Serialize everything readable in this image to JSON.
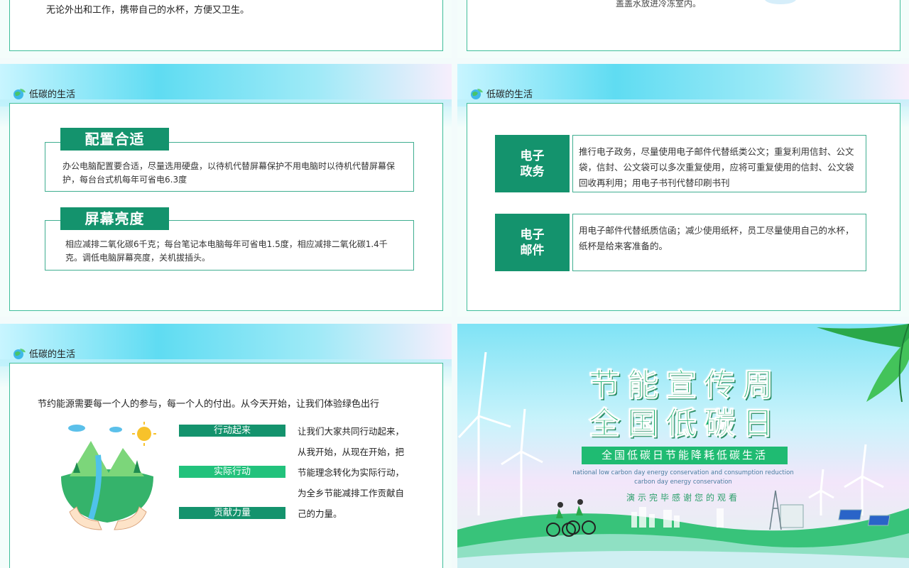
{
  "slide1": {
    "text": "无论外出和工作，携带自己的水杯，方便又卫生。"
  },
  "slide2": {
    "text": "盖盖水放进冷冻室内。"
  },
  "slide3": {
    "section_title": "低碳的生活",
    "items": [
      {
        "heading": "配置合适",
        "desc": "办公电脑配置要合适，尽量选用硬盘，以待机代替屏幕保护不用电脑时以待机代替屏幕保护，每台台式机每年可省电6.3度"
      },
      {
        "heading": "屏幕亮度",
        "desc": "相应减排二氧化碳6千克；每台笔记本电脑每年可省电1.5度，相应减排二氧化碳1.4千克。调低电脑屏幕亮度，关机拔插头。"
      }
    ]
  },
  "slide4": {
    "section_title": "低碳的生活",
    "items": [
      {
        "label": "电子\n政务",
        "desc": "推行电子政务，尽量使用电子邮件代替纸类公文；重复利用信封、公文袋，信封、公文袋可以多次重复使用，应将可重复使用的信封、公文袋回收再利用；用电子书刊代替印刷书刊"
      },
      {
        "label": "电子\n邮件",
        "desc": "用电子邮件代替纸质信函；减少使用纸杯，员工尽量使用自己的水杯，纸杯是给来客准备的。"
      }
    ]
  },
  "slide5": {
    "section_title": "低碳的生活",
    "intro": "节约能源需要每一个人的参与，每一个人的付出。从今天开始，让我们体验绿色出行",
    "actions": [
      "行动起来",
      "实际行动",
      "贡献力量"
    ],
    "action_colors": [
      "#14936d",
      "#22c27c",
      "#14936d"
    ],
    "side_text": "让我们大家共同行动起来，从我开始，从现在开始，把节能理念转化为实际行动，为全乡节能减排工作贡献自己的力量。"
  },
  "slide6": {
    "title_line1": "节能宣传周",
    "title_line2": "全国低碳日",
    "banner": "全国低碳日节能降耗低碳生活",
    "en_line1": "national low carbon day energy conservation and consumption reduction",
    "en_line2": "carbon day energy conservation",
    "thanks": "演示完毕感谢您的观看"
  },
  "colors": {
    "accent_dark": "#14936d",
    "accent_light": "#22c27c",
    "panel_border": "#3fbe9a",
    "title_green": "#16b06c"
  }
}
